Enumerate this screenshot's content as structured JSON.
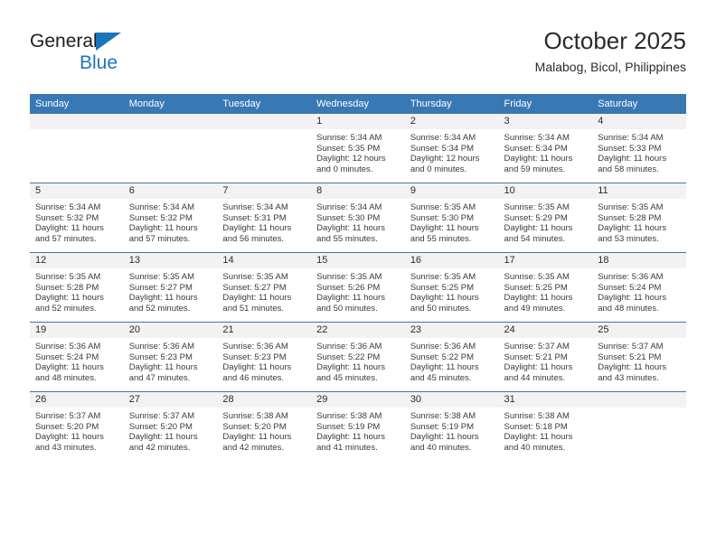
{
  "brand": {
    "name_part1": "General",
    "name_part2": "Blue"
  },
  "header": {
    "title": "October 2025",
    "subtitle": "Malabog, Bicol, Philippines"
  },
  "colors": {
    "header_blue": "#3878b4",
    "brand_blue": "#1b75bb",
    "daynum_band": "#f2f2f2",
    "text": "#2b2b2b"
  },
  "weekday_headers": [
    "Sunday",
    "Monday",
    "Tuesday",
    "Wednesday",
    "Thursday",
    "Friday",
    "Saturday"
  ],
  "weeks": [
    [
      {
        "day": "",
        "sunrise": "",
        "sunset": "",
        "daylight1": "",
        "daylight2": ""
      },
      {
        "day": "",
        "sunrise": "",
        "sunset": "",
        "daylight1": "",
        "daylight2": ""
      },
      {
        "day": "",
        "sunrise": "",
        "sunset": "",
        "daylight1": "",
        "daylight2": ""
      },
      {
        "day": "1",
        "sunrise": "Sunrise: 5:34 AM",
        "sunset": "Sunset: 5:35 PM",
        "daylight1": "Daylight: 12 hours",
        "daylight2": "and 0 minutes."
      },
      {
        "day": "2",
        "sunrise": "Sunrise: 5:34 AM",
        "sunset": "Sunset: 5:34 PM",
        "daylight1": "Daylight: 12 hours",
        "daylight2": "and 0 minutes."
      },
      {
        "day": "3",
        "sunrise": "Sunrise: 5:34 AM",
        "sunset": "Sunset: 5:34 PM",
        "daylight1": "Daylight: 11 hours",
        "daylight2": "and 59 minutes."
      },
      {
        "day": "4",
        "sunrise": "Sunrise: 5:34 AM",
        "sunset": "Sunset: 5:33 PM",
        "daylight1": "Daylight: 11 hours",
        "daylight2": "and 58 minutes."
      }
    ],
    [
      {
        "day": "5",
        "sunrise": "Sunrise: 5:34 AM",
        "sunset": "Sunset: 5:32 PM",
        "daylight1": "Daylight: 11 hours",
        "daylight2": "and 57 minutes."
      },
      {
        "day": "6",
        "sunrise": "Sunrise: 5:34 AM",
        "sunset": "Sunset: 5:32 PM",
        "daylight1": "Daylight: 11 hours",
        "daylight2": "and 57 minutes."
      },
      {
        "day": "7",
        "sunrise": "Sunrise: 5:34 AM",
        "sunset": "Sunset: 5:31 PM",
        "daylight1": "Daylight: 11 hours",
        "daylight2": "and 56 minutes."
      },
      {
        "day": "8",
        "sunrise": "Sunrise: 5:34 AM",
        "sunset": "Sunset: 5:30 PM",
        "daylight1": "Daylight: 11 hours",
        "daylight2": "and 55 minutes."
      },
      {
        "day": "9",
        "sunrise": "Sunrise: 5:35 AM",
        "sunset": "Sunset: 5:30 PM",
        "daylight1": "Daylight: 11 hours",
        "daylight2": "and 55 minutes."
      },
      {
        "day": "10",
        "sunrise": "Sunrise: 5:35 AM",
        "sunset": "Sunset: 5:29 PM",
        "daylight1": "Daylight: 11 hours",
        "daylight2": "and 54 minutes."
      },
      {
        "day": "11",
        "sunrise": "Sunrise: 5:35 AM",
        "sunset": "Sunset: 5:28 PM",
        "daylight1": "Daylight: 11 hours",
        "daylight2": "and 53 minutes."
      }
    ],
    [
      {
        "day": "12",
        "sunrise": "Sunrise: 5:35 AM",
        "sunset": "Sunset: 5:28 PM",
        "daylight1": "Daylight: 11 hours",
        "daylight2": "and 52 minutes."
      },
      {
        "day": "13",
        "sunrise": "Sunrise: 5:35 AM",
        "sunset": "Sunset: 5:27 PM",
        "daylight1": "Daylight: 11 hours",
        "daylight2": "and 52 minutes."
      },
      {
        "day": "14",
        "sunrise": "Sunrise: 5:35 AM",
        "sunset": "Sunset: 5:27 PM",
        "daylight1": "Daylight: 11 hours",
        "daylight2": "and 51 minutes."
      },
      {
        "day": "15",
        "sunrise": "Sunrise: 5:35 AM",
        "sunset": "Sunset: 5:26 PM",
        "daylight1": "Daylight: 11 hours",
        "daylight2": "and 50 minutes."
      },
      {
        "day": "16",
        "sunrise": "Sunrise: 5:35 AM",
        "sunset": "Sunset: 5:25 PM",
        "daylight1": "Daylight: 11 hours",
        "daylight2": "and 50 minutes."
      },
      {
        "day": "17",
        "sunrise": "Sunrise: 5:35 AM",
        "sunset": "Sunset: 5:25 PM",
        "daylight1": "Daylight: 11 hours",
        "daylight2": "and 49 minutes."
      },
      {
        "day": "18",
        "sunrise": "Sunrise: 5:36 AM",
        "sunset": "Sunset: 5:24 PM",
        "daylight1": "Daylight: 11 hours",
        "daylight2": "and 48 minutes."
      }
    ],
    [
      {
        "day": "19",
        "sunrise": "Sunrise: 5:36 AM",
        "sunset": "Sunset: 5:24 PM",
        "daylight1": "Daylight: 11 hours",
        "daylight2": "and 48 minutes."
      },
      {
        "day": "20",
        "sunrise": "Sunrise: 5:36 AM",
        "sunset": "Sunset: 5:23 PM",
        "daylight1": "Daylight: 11 hours",
        "daylight2": "and 47 minutes."
      },
      {
        "day": "21",
        "sunrise": "Sunrise: 5:36 AM",
        "sunset": "Sunset: 5:23 PM",
        "daylight1": "Daylight: 11 hours",
        "daylight2": "and 46 minutes."
      },
      {
        "day": "22",
        "sunrise": "Sunrise: 5:36 AM",
        "sunset": "Sunset: 5:22 PM",
        "daylight1": "Daylight: 11 hours",
        "daylight2": "and 45 minutes."
      },
      {
        "day": "23",
        "sunrise": "Sunrise: 5:36 AM",
        "sunset": "Sunset: 5:22 PM",
        "daylight1": "Daylight: 11 hours",
        "daylight2": "and 45 minutes."
      },
      {
        "day": "24",
        "sunrise": "Sunrise: 5:37 AM",
        "sunset": "Sunset: 5:21 PM",
        "daylight1": "Daylight: 11 hours",
        "daylight2": "and 44 minutes."
      },
      {
        "day": "25",
        "sunrise": "Sunrise: 5:37 AM",
        "sunset": "Sunset: 5:21 PM",
        "daylight1": "Daylight: 11 hours",
        "daylight2": "and 43 minutes."
      }
    ],
    [
      {
        "day": "26",
        "sunrise": "Sunrise: 5:37 AM",
        "sunset": "Sunset: 5:20 PM",
        "daylight1": "Daylight: 11 hours",
        "daylight2": "and 43 minutes."
      },
      {
        "day": "27",
        "sunrise": "Sunrise: 5:37 AM",
        "sunset": "Sunset: 5:20 PM",
        "daylight1": "Daylight: 11 hours",
        "daylight2": "and 42 minutes."
      },
      {
        "day": "28",
        "sunrise": "Sunrise: 5:38 AM",
        "sunset": "Sunset: 5:20 PM",
        "daylight1": "Daylight: 11 hours",
        "daylight2": "and 42 minutes."
      },
      {
        "day": "29",
        "sunrise": "Sunrise: 5:38 AM",
        "sunset": "Sunset: 5:19 PM",
        "daylight1": "Daylight: 11 hours",
        "daylight2": "and 41 minutes."
      },
      {
        "day": "30",
        "sunrise": "Sunrise: 5:38 AM",
        "sunset": "Sunset: 5:19 PM",
        "daylight1": "Daylight: 11 hours",
        "daylight2": "and 40 minutes."
      },
      {
        "day": "31",
        "sunrise": "Sunrise: 5:38 AM",
        "sunset": "Sunset: 5:18 PM",
        "daylight1": "Daylight: 11 hours",
        "daylight2": "and 40 minutes."
      },
      {
        "day": "",
        "sunrise": "",
        "sunset": "",
        "daylight1": "",
        "daylight2": ""
      }
    ]
  ]
}
